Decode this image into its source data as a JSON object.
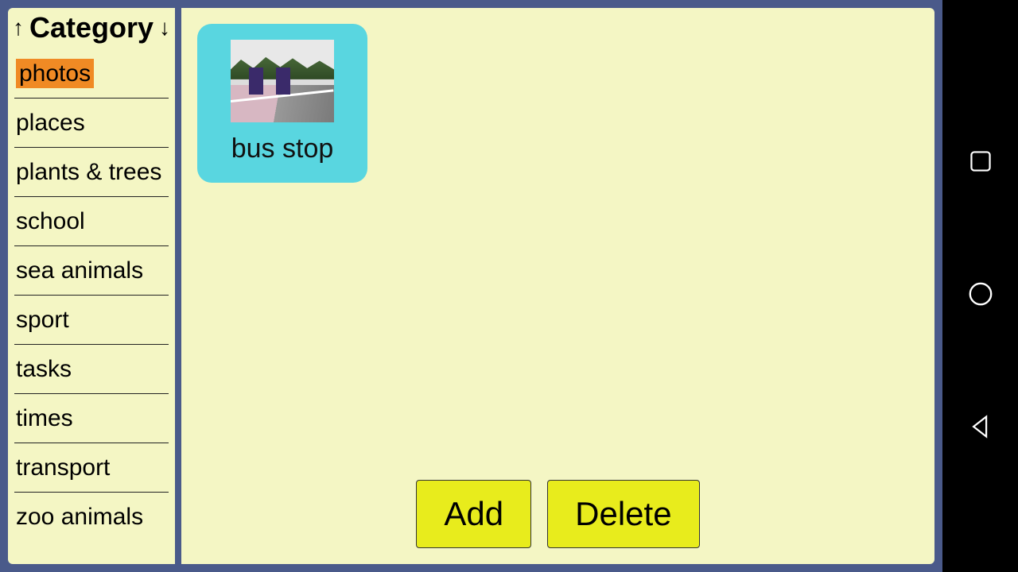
{
  "sidebar": {
    "title": "Category",
    "sort_up_icon": "↑",
    "sort_down_icon": "↓",
    "selected_index": 0,
    "items": [
      {
        "label": "photos"
      },
      {
        "label": "places"
      },
      {
        "label": "plants & trees"
      },
      {
        "label": "school"
      },
      {
        "label": "sea animals"
      },
      {
        "label": "sport"
      },
      {
        "label": "tasks"
      },
      {
        "label": "times"
      },
      {
        "label": "transport"
      },
      {
        "label": "zoo animals"
      }
    ]
  },
  "content": {
    "cards": [
      {
        "label": "bus stop",
        "image_name": "bus-stop-photo"
      }
    ]
  },
  "actions": {
    "add_label": "Add",
    "delete_label": "Delete"
  },
  "colors": {
    "frame": "#4a5a8a",
    "panel": "#f4f6c4",
    "card": "#59d6e0",
    "selected": "#f08a24",
    "button": "#e8ec1c"
  },
  "nav": {
    "overview_icon": "overview-icon",
    "home_icon": "home-icon",
    "back_icon": "back-icon"
  }
}
